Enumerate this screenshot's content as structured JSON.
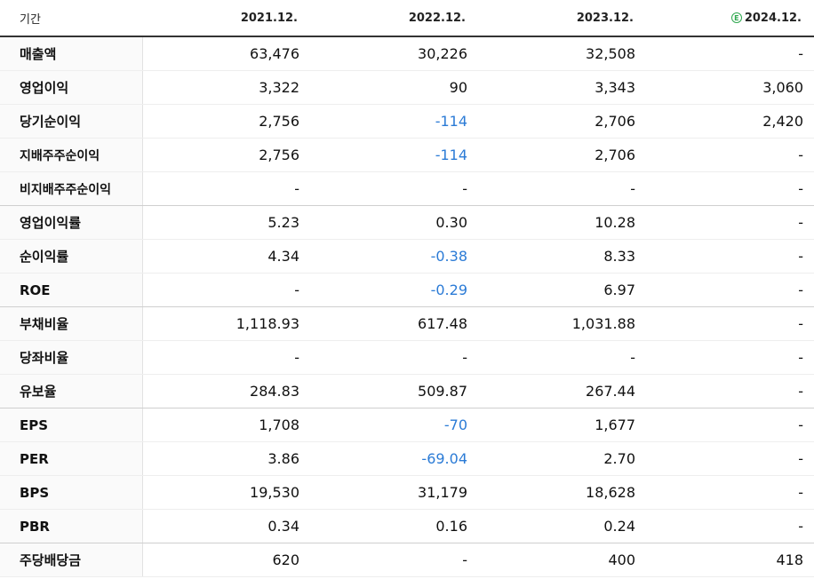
{
  "header": {
    "period_label": "기간",
    "years": [
      "2021.12.",
      "2022.12.",
      "2023.12.",
      "2024.12."
    ],
    "estimate_icon": "E"
  },
  "colors": {
    "negative": "#2b7bd6",
    "estimate": "#2fa84f"
  },
  "rows": [
    {
      "label": "매출액",
      "values": [
        "63,476",
        "30,226",
        "32,508",
        "-"
      ]
    },
    {
      "label": "영업이익",
      "values": [
        "3,322",
        "90",
        "3,343",
        "3,060"
      ]
    },
    {
      "label": "당기순이익",
      "values": [
        "2,756",
        "-114",
        "2,706",
        "2,420"
      ]
    },
    {
      "label": "지배주주순이익",
      "values": [
        "2,756",
        "-114",
        "2,706",
        "-"
      ]
    },
    {
      "label": "비지배주주순이익",
      "values": [
        "-",
        "-",
        "-",
        "-"
      ]
    },
    {
      "label": "영업이익률",
      "values": [
        "5.23",
        "0.30",
        "10.28",
        "-"
      ]
    },
    {
      "label": "순이익률",
      "values": [
        "4.34",
        "-0.38",
        "8.33",
        "-"
      ]
    },
    {
      "label": "ROE",
      "values": [
        "-",
        "-0.29",
        "6.97",
        "-"
      ]
    },
    {
      "label": "부채비율",
      "values": [
        "1,118.93",
        "617.48",
        "1,031.88",
        "-"
      ]
    },
    {
      "label": "당좌비율",
      "values": [
        "-",
        "-",
        "-",
        "-"
      ]
    },
    {
      "label": "유보율",
      "values": [
        "284.83",
        "509.87",
        "267.44",
        "-"
      ]
    },
    {
      "label": "EPS",
      "values": [
        "1,708",
        "-70",
        "1,677",
        "-"
      ]
    },
    {
      "label": "PER",
      "values": [
        "3.86",
        "-69.04",
        "2.70",
        "-"
      ]
    },
    {
      "label": "BPS",
      "values": [
        "19,530",
        "31,179",
        "18,628",
        "-"
      ]
    },
    {
      "label": "PBR",
      "values": [
        "0.34",
        "0.16",
        "0.24",
        "-"
      ]
    },
    {
      "label": "주당배당금",
      "values": [
        "620",
        "-",
        "400",
        "418"
      ]
    }
  ]
}
